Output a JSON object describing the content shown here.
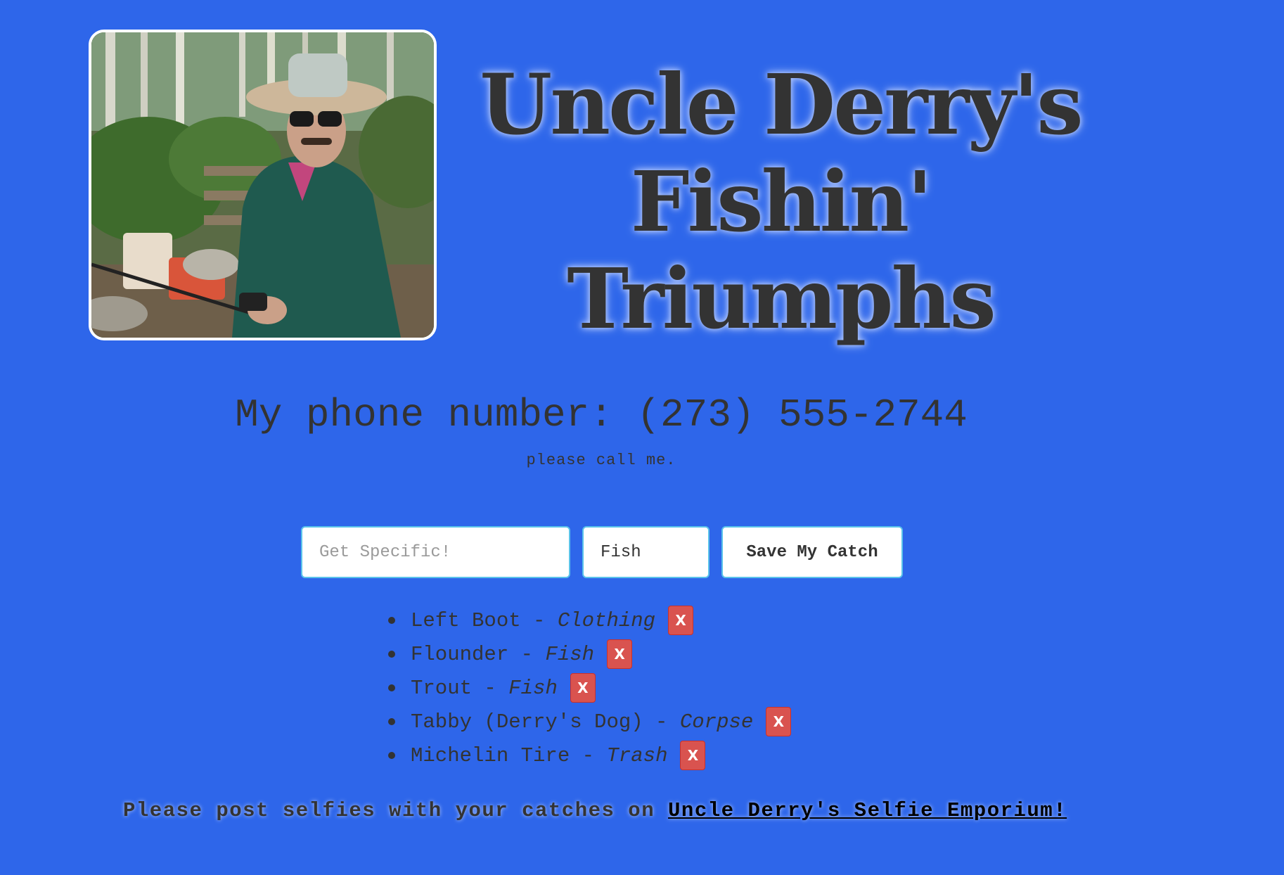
{
  "header": {
    "photo_alt": "Uncle Derry fishing photo",
    "title_lines": [
      "Uncle Derry's",
      "Fishin'",
      "Triumphs"
    ]
  },
  "contact": {
    "phone_label": "My phone number: (273) 555-2744",
    "subtitle": "please call me."
  },
  "form": {
    "name_placeholder": "Get Specific!",
    "name_value": "",
    "type_value": "Fish",
    "save_label": "Save My Catch"
  },
  "catches": [
    {
      "name": "Left Boot",
      "separator": " - ",
      "type": "Clothing",
      "delete_label": "X"
    },
    {
      "name": "Flounder",
      "separator": " - ",
      "type": "Fish",
      "delete_label": "X"
    },
    {
      "name": "Trout",
      "separator": " - ",
      "type": "Fish",
      "delete_label": "X"
    },
    {
      "name": "Tabby (Derry's Dog)",
      "separator": " - ",
      "type": "Corpse",
      "delete_label": "X"
    },
    {
      "name": "Michelin Tire",
      "separator": " - ",
      "type": "Trash",
      "delete_label": "X"
    }
  ],
  "footer": {
    "text": "Please post selfies with your catches on ",
    "link_text": "Uncle Derry's Selfie Emporium!"
  },
  "colors": {
    "background": "#2e66ea",
    "text": "#333333",
    "delete_button": "#d9534f",
    "input_border": "#5ac3ea"
  }
}
